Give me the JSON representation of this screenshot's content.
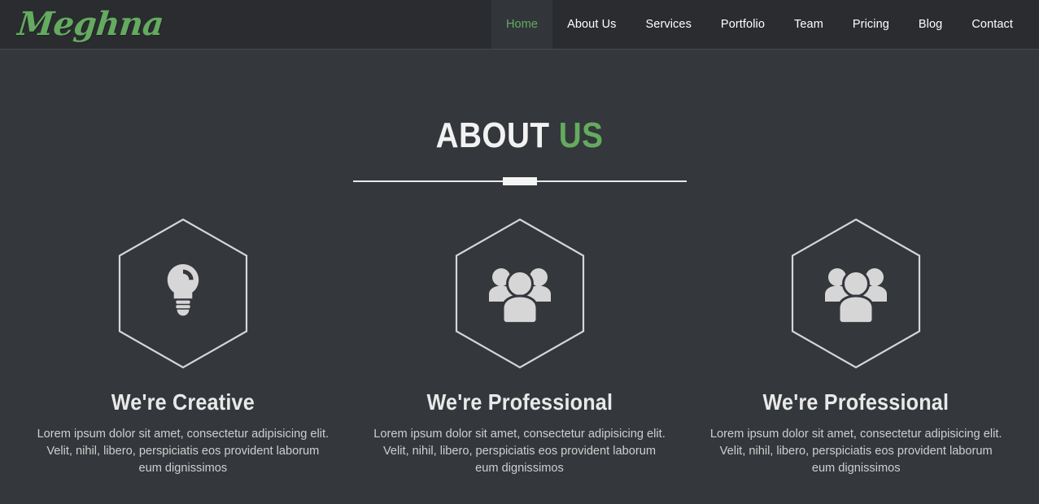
{
  "header": {
    "brand": "Meghna",
    "nav_items": [
      {
        "label": "Home",
        "active": true
      },
      {
        "label": "About Us",
        "active": false
      },
      {
        "label": "Services",
        "active": false
      },
      {
        "label": "Portfolio",
        "active": false
      },
      {
        "label": "Team",
        "active": false
      },
      {
        "label": "Pricing",
        "active": false
      },
      {
        "label": "Blog",
        "active": false
      },
      {
        "label": "Contact",
        "active": false
      }
    ]
  },
  "about": {
    "title_main": "ABOUT",
    "title_accent": "US",
    "cards": [
      {
        "icon": "lightbulb-icon",
        "title": "We're Creative",
        "text": "Lorem ipsum dolor sit amet, consectetur adipisicing elit. Velit, nihil, libero, perspiciatis eos provident laborum eum dignissimos"
      },
      {
        "icon": "group-people-icon",
        "title": "We're Professional",
        "text": "Lorem ipsum dolor sit amet, consectetur adipisicing elit. Velit, nihil, libero, perspiciatis eos provident laborum eum dignissimos"
      },
      {
        "icon": "group-people-icon",
        "title": "We're Professional",
        "text": "Lorem ipsum dolor sit amet, consectetur adipisicing elit. Velit, nihil, libero, perspiciatis eos provident laborum eum dignissimos"
      }
    ]
  },
  "colors": {
    "accent_green": "#64ab5f",
    "header_bg": "#2a2c30",
    "body_bg": "#34373c",
    "icon_gray": "#d6d6d6"
  }
}
